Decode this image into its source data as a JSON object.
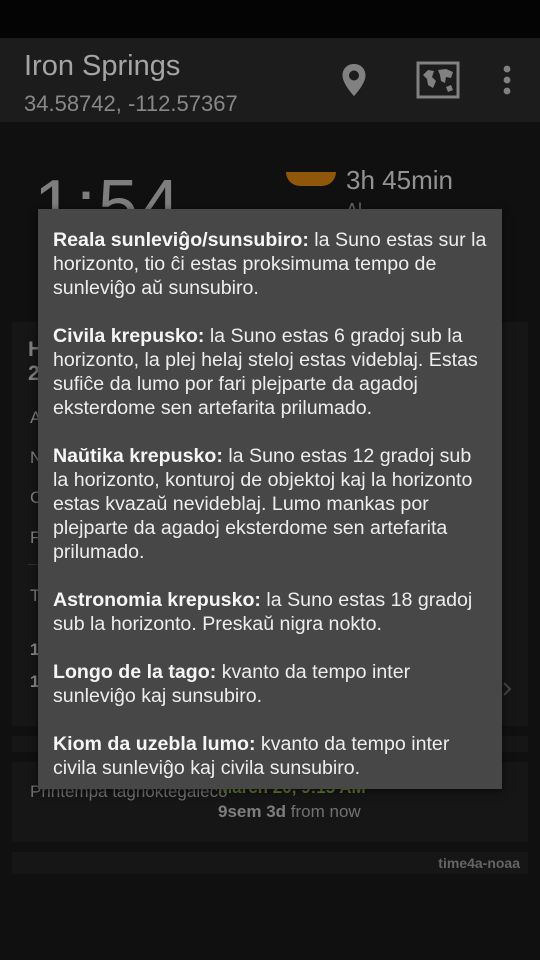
{
  "app_bar": {
    "title": "Iron Springs",
    "subtitle": "34.58742, -112.57367",
    "icons": [
      "location-pin-icon",
      "map-icon",
      "overflow-menu-icon"
    ]
  },
  "background": {
    "big_time": "1:54",
    "day_length": "3h 45min",
    "day_length_sub": "Al...",
    "card_peeks": {
      "header_line1": "H",
      "header_line2": "2",
      "row_a": "A",
      "row_n": "N",
      "row_c": "C",
      "row_f": "F",
      "row_t": "T",
      "row_1a": "1",
      "row_1b": "1"
    },
    "season": {
      "label": "Printempa tagnoktegaleco",
      "date": "March 20, 9:15 AM",
      "countdown_bold": "9sem 3d",
      "countdown_rest": " from now"
    },
    "credit": "time4a-noaa"
  },
  "dialog": {
    "entries": [
      {
        "term": "Reala sunleviĝo/sunsubiro:",
        "text": " la Suno estas sur la horizonto, tio ĉi estas proksimuma tempo de sunleviĝo aŭ sunsubiro."
      },
      {
        "term": "Civila krepusko:",
        "text": " la Suno estas 6 gradoj sub la horizonto, la plej helaj steloj estas videblaj. Estas sufiĉe da lumo por fari plejparte da agadoj eksterdome sen artefarita prilumado."
      },
      {
        "term": "Naŭtika krepusko:",
        "text": " la Suno estas 12 gradoj sub la horizonto, konturoj de objektoj kaj la horizonto estas kvazaŭ nevideblaj. Lumo mankas por plejparte da agadoj eksterdome sen artefarita prilumado."
      },
      {
        "term": "Astronomia krepusko:",
        "text": " la Suno estas 18 gradoj sub la horizonto. Preskaŭ nigra nokto."
      },
      {
        "term": "Longo de la tago:",
        "text": " kvanto da tempo inter sunleviĝo kaj sunsubiro."
      },
      {
        "term": "Kiom da uzebla lumo:",
        "text": " kvanto da tempo inter civila sunleviĝo kaj civila sunsubiro."
      }
    ]
  },
  "colors": {
    "app_bar": "#232323",
    "status_bar": "#050505",
    "dialog": "#474747",
    "season_date": "#7d9a3a",
    "sun_arc": "#b06a0c"
  }
}
